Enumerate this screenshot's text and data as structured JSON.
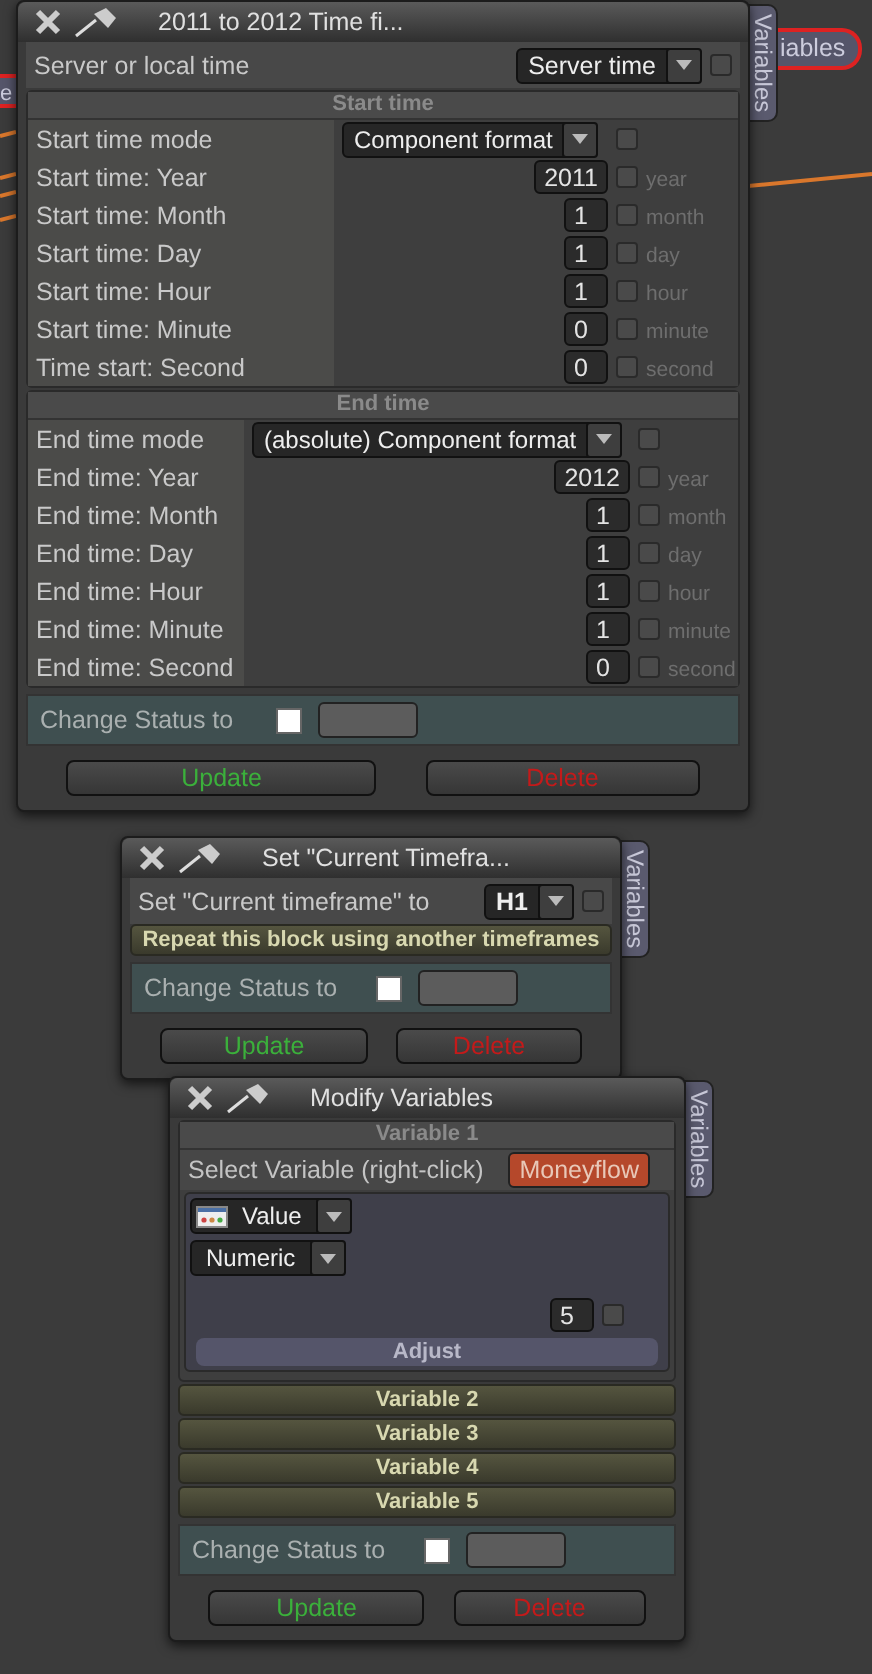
{
  "canvas": {
    "left_tag": "e",
    "right_tag": "iables"
  },
  "panels": [
    {
      "kind": "time",
      "title": "2011 to 2012 Time fi...",
      "side_tab": "Variables",
      "server": {
        "label": "Server or local time",
        "value": "Server time",
        "checked": false
      },
      "sections": [
        {
          "heading": "Start time",
          "mode_label": "Start time mode",
          "mode_value": "Component format",
          "mode_checked": false,
          "fields": [
            {
              "label": "Start time: Year",
              "value": "2011",
              "unit": "year",
              "checked": false
            },
            {
              "label": "Start time: Month",
              "value": "1",
              "unit": "month",
              "checked": false
            },
            {
              "label": "Start time: Day",
              "value": "1",
              "unit": "day",
              "checked": false
            },
            {
              "label": "Start time: Hour",
              "value": "1",
              "unit": "hour",
              "checked": false
            },
            {
              "label": "Start time: Minute",
              "value": "0",
              "unit": "minute",
              "checked": false
            },
            {
              "label": "Time start: Second",
              "value": "0",
              "unit": "second",
              "checked": false
            }
          ]
        },
        {
          "heading": "End time",
          "mode_label": "End time mode",
          "mode_value": "(absolute) Component format",
          "mode_checked": false,
          "fields": [
            {
              "label": "End time: Year",
              "value": "2012",
              "unit": "year",
              "checked": false
            },
            {
              "label": "End time: Month",
              "value": "1",
              "unit": "month",
              "checked": false
            },
            {
              "label": "End time: Day",
              "value": "1",
              "unit": "day",
              "checked": false
            },
            {
              "label": "End time: Hour",
              "value": "1",
              "unit": "hour",
              "checked": false
            },
            {
              "label": "End time: Minute",
              "value": "1",
              "unit": "minute",
              "checked": false
            },
            {
              "label": "End time: Second",
              "value": "0",
              "unit": "second",
              "checked": false
            }
          ]
        }
      ],
      "status": {
        "label": "Change Status to",
        "checked": false
      },
      "buttons": [
        {
          "label": "Update",
          "kind": "update"
        },
        {
          "label": "Delete",
          "kind": "delete"
        }
      ]
    },
    {
      "kind": "timeframe",
      "title": "Set \"Current Timefra...",
      "side_tab": "Variables",
      "setting": {
        "label": "Set \"Current timeframe\" to",
        "value": "H1",
        "checked": false
      },
      "repeat_bar": "Repeat this block using another timeframes",
      "status": {
        "label": "Change Status to",
        "checked": false
      },
      "buttons": [
        {
          "label": "Update",
          "kind": "update"
        },
        {
          "label": "Delete",
          "kind": "delete"
        }
      ]
    },
    {
      "kind": "variables",
      "title": "Modify Variables",
      "side_tab": "Variables",
      "variables": [
        {
          "heading": "Variable 1",
          "expanded": true,
          "select_label": "Select Variable (right-click)",
          "variable": "Moneyflow",
          "source": "Value",
          "type": "Numeric",
          "number": "5",
          "checked": false,
          "adjust": "Adjust"
        },
        {
          "heading": "Variable 2",
          "expanded": false
        },
        {
          "heading": "Variable 3",
          "expanded": false
        },
        {
          "heading": "Variable 4",
          "expanded": false
        },
        {
          "heading": "Variable 5",
          "expanded": false
        }
      ],
      "status": {
        "label": "Change Status to",
        "checked": false
      },
      "buttons": [
        {
          "label": "Update",
          "kind": "update"
        },
        {
          "label": "Delete",
          "kind": "delete"
        }
      ]
    }
  ]
}
